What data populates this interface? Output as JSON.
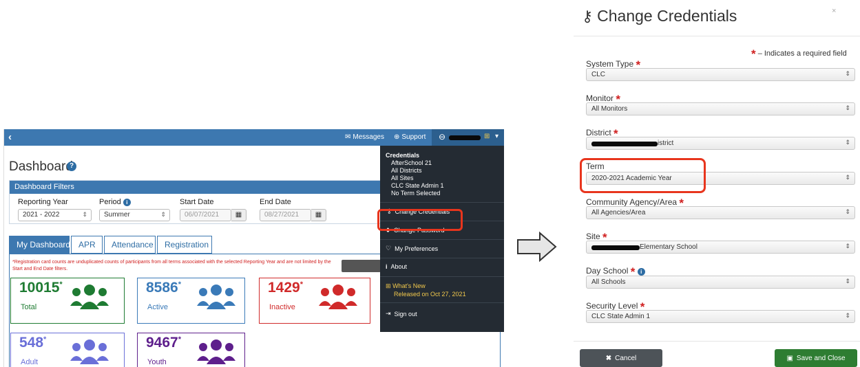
{
  "dashboard": {
    "navbar": {
      "back": "‹",
      "messages": "Messages",
      "support": "Support"
    },
    "title": "Dashboard",
    "filters": {
      "header": "Dashboard Filters",
      "reporting_year_label": "Reporting Year",
      "reporting_year_value": "2021 - 2022",
      "period_label": "Period",
      "period_value": "Summer",
      "start_date_label": "Start Date",
      "start_date_value": "06/07/2021",
      "end_date_label": "End Date",
      "end_date_value": "08/27/2021"
    },
    "tabs": [
      "My Dashboard",
      "APR",
      "Attendance",
      "Registration"
    ],
    "note": "*Registration card counts are unduplicated counts of participants from all terms associated with the selected Reporting Year and are not limited by the Start and End Date filters.",
    "cards": [
      {
        "value": "10015",
        "label": "Total",
        "color": "#1e7b32"
      },
      {
        "value": "8586",
        "label": "Active",
        "color": "#3a7ab8"
      },
      {
        "value": "1429",
        "label": "Inactive",
        "color": "#d02a2a"
      },
      {
        "value": "548",
        "label": "Adult",
        "color": "#6a6fd8"
      },
      {
        "value": "9467",
        "label": "Youth",
        "color": "#5e1f8c"
      }
    ],
    "menu": {
      "credentials_heading": "Credentials",
      "credentials": [
        "AfterSchool 21",
        "All Districts",
        "All Sites",
        "CLC State Admin 1",
        "No Term Selected"
      ],
      "change_credentials": "Change Credentials",
      "change_password": "Change Password",
      "my_preferences": "My Preferences",
      "about": "About",
      "whats_new": "What's New",
      "released": "Released on Oct 27, 2021",
      "sign_out": "Sign out"
    }
  },
  "modal": {
    "title": "Change Credentials",
    "close": "×",
    "required_note": "– Indicates a required field",
    "fields": {
      "system_type": {
        "label": "System Type",
        "value": "CLC"
      },
      "monitor": {
        "label": "Monitor",
        "value": "All Monitors"
      },
      "district": {
        "label": "District",
        "value": "istrict"
      },
      "term": {
        "label": "Term",
        "value": "2020-2021 Academic Year"
      },
      "agency": {
        "label": "Community Agency/Area",
        "value": "All Agencies/Area"
      },
      "site": {
        "label": "Site",
        "value": "Elementary School"
      },
      "day_school": {
        "label": "Day School",
        "value": "All Schools"
      },
      "security_level": {
        "label": "Security Level",
        "value": "CLC State Admin 1"
      }
    },
    "cancel": "Cancel",
    "save": "Save and Close"
  },
  "colors": {
    "primary": "#3d78b0",
    "menu_bg": "#242b33",
    "highlight": "#e8351d",
    "cancel_bg": "#4d5358",
    "save_bg": "#2e7d32"
  }
}
